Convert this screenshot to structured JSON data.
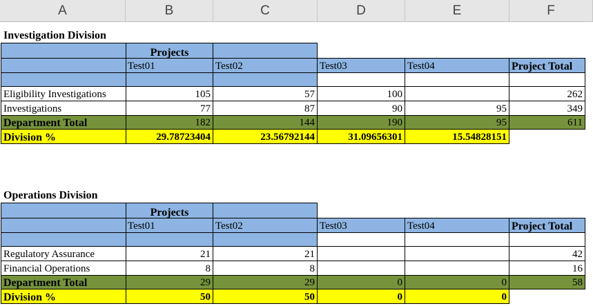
{
  "columns": [
    "A",
    "B",
    "C",
    "D",
    "E",
    "F"
  ],
  "investigation": {
    "title": "Investigation Division",
    "projects_label": "Projects",
    "headers": [
      "Test01",
      "Test02",
      "Test03",
      "Test04",
      "Project Total"
    ],
    "rows": [
      {
        "label": "Eligibility Investigations",
        "values": [
          "105",
          "57",
          "100",
          "",
          "262"
        ]
      },
      {
        "label": "Investigations",
        "values": [
          "77",
          "87",
          "90",
          "95",
          "349"
        ]
      }
    ],
    "dept_total": {
      "label": "Department Total",
      "values": [
        "182",
        "144",
        "190",
        "95",
        "611"
      ]
    },
    "division_pct": {
      "label": "Division %",
      "values": [
        "29.78723404",
        "23.56792144",
        "31.09656301",
        "15.54828151"
      ]
    }
  },
  "operations": {
    "title": "Operations Division",
    "projects_label": "Projects",
    "headers": [
      "Test01",
      "Test02",
      "Test03",
      "Test04",
      "Project Total"
    ],
    "rows": [
      {
        "label": "Regulatory Assurance",
        "values": [
          "21",
          "21",
          "",
          "",
          "42"
        ]
      },
      {
        "label": "Financial Operations",
        "values": [
          "8",
          "8",
          "",
          "",
          "16"
        ]
      }
    ],
    "dept_total": {
      "label": "Department Total",
      "values": [
        "29",
        "29",
        "0",
        "0",
        "58"
      ]
    },
    "division_pct": {
      "label": "Division %",
      "values": [
        "50",
        "50",
        "0",
        "0"
      ]
    }
  },
  "colors": {
    "header_blue": "#8db4e2",
    "total_green": "#76933c",
    "pct_yellow": "#ffff00"
  }
}
